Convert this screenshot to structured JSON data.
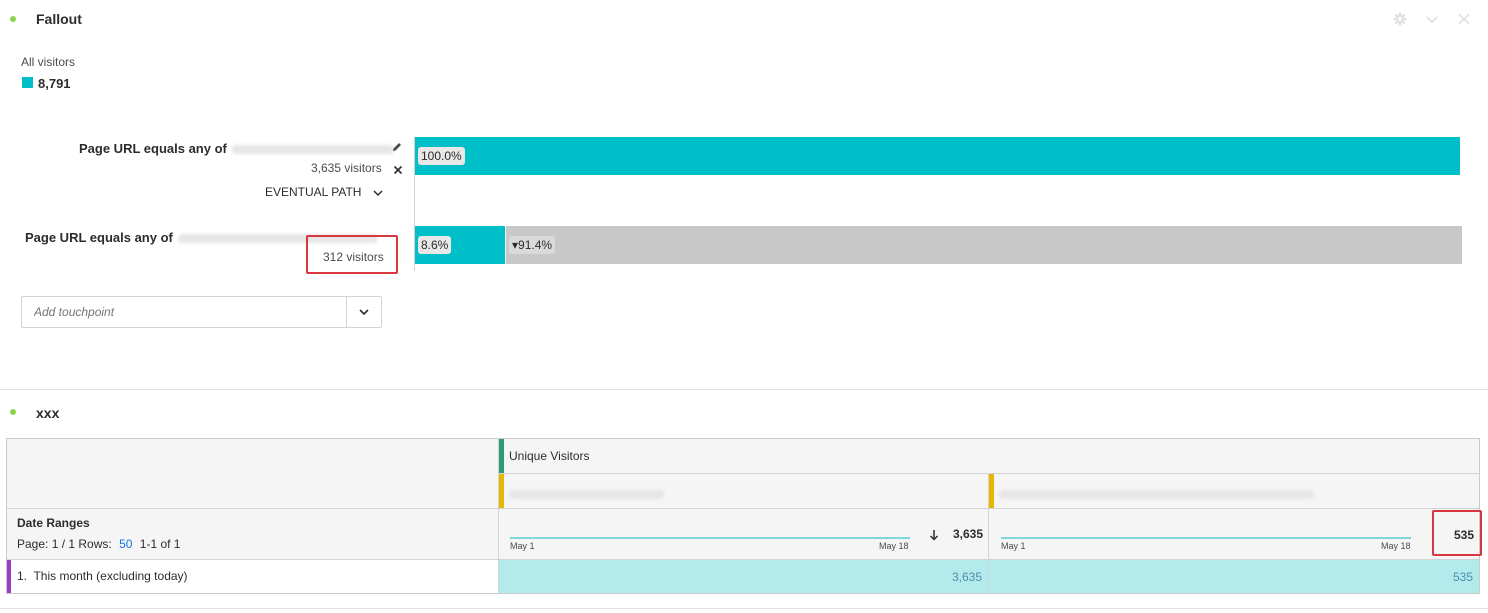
{
  "fallout": {
    "title": "Fallout",
    "segment_label": "All visitors",
    "segment_value": "8,791",
    "touchpoints": [
      {
        "title": "Page URL equals any of",
        "visitors": "3,635 visitors",
        "path_mode": "EVENTUAL PATH",
        "bar_percent": "100.0%",
        "bar_fraction": 1.0
      },
      {
        "title": "Page URL equals any of",
        "visitors": "312 visitors",
        "bar_percent": "8.6%",
        "dropoff_percent": "▾91.4%",
        "bar_fraction": 0.086
      }
    ],
    "add_touchpoint_placeholder": "Add touchpoint"
  },
  "freeform": {
    "title": "xxx",
    "metric_header": "Unique Visitors",
    "dimension_header": "Date Ranges",
    "pagination": {
      "page_label": "Page: 1 / 1",
      "rows_label": "Rows:",
      "rows_value": "50",
      "range_label": "1-1 of 1"
    },
    "columns": [
      {
        "spark_start": "May 1",
        "spark_end": "May 18",
        "total": "3,635",
        "sort_icon": "arrow-down-icon"
      },
      {
        "spark_start": "May 1",
        "spark_end": "May 18",
        "total": "535"
      }
    ],
    "rows": [
      {
        "label": "1.  This month (excluding today)",
        "values": [
          "3,635",
          "535"
        ]
      }
    ]
  },
  "colors": {
    "accent": "#00bfc8",
    "dropoff": "#c8c8c8",
    "highlight": "#d7373f",
    "panel_dot": "#8fd14f",
    "cell_fill": "#b3eaec"
  }
}
